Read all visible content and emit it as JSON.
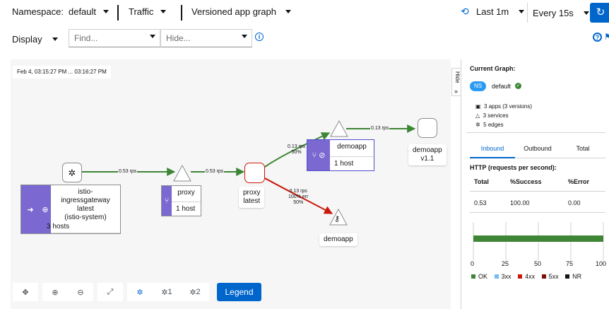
{
  "toolbar": {
    "namespace_label": "Namespace:",
    "namespace_value": "default",
    "traffic_label": "Traffic",
    "graph_type": "Versioned app graph",
    "duration": "Last 1m",
    "refresh_interval": "Every 15s"
  },
  "filters": {
    "display_label": "Display",
    "find_placeholder": "Find...",
    "hide_placeholder": "Hide..."
  },
  "graph": {
    "time_range": "Feb 4, 03:15:27 PM ... 03:16:27 PM",
    "hide_tab": "Hide",
    "edges": [
      {
        "label": "0.53 rps"
      },
      {
        "label": "0.53 rps"
      },
      {
        "label": "0.13 rps",
        "label2": "50%"
      },
      {
        "label": "0.13 rps"
      },
      {
        "label": "0.13 rps",
        "label2": "100% err",
        "label3": "50%"
      }
    ],
    "nodes": {
      "ingress": {
        "title_line1": "istio-ingressgateway",
        "title_line2": "latest",
        "title_line3": "(istio-system)",
        "hosts": "3 hosts"
      },
      "proxy_group": {
        "title": "proxy",
        "hosts": "1 host"
      },
      "proxy_latest": {
        "line1": "proxy",
        "line2": "latest"
      },
      "demoapp_group": {
        "title": "demoapp",
        "hosts": "1 host"
      },
      "demoapp_v11": {
        "line1": "demoapp",
        "line2": "v1.1"
      },
      "demoapp_ext": {
        "line1": "demoapp"
      }
    },
    "controls": {
      "layout1": "1",
      "layout2": "2",
      "legend": "Legend"
    }
  },
  "side": {
    "title": "Current Graph:",
    "ns_badge": "NS",
    "namespace": "default",
    "apps": "3 apps (3 versions)",
    "services": "3 services",
    "edges": "5 edges",
    "tabs": [
      "Inbound",
      "Outbound",
      "Total"
    ],
    "http_title": "HTTP (requests per second):",
    "table": {
      "headers": [
        "Total",
        "%Success",
        "%Error"
      ],
      "values": [
        "0.53",
        "100.00",
        "0.00"
      ]
    },
    "chart_ticks": [
      "0",
      "25",
      "50",
      "75",
      "100"
    ],
    "legend": [
      "OK",
      "3xx",
      "4xx",
      "5xx",
      "NR"
    ],
    "colors": {
      "ok": "#3e8635",
      "3xx": "#73bcf7",
      "4xx": "#c9190b",
      "5xx": "#7d1007",
      "nr": "#151515"
    }
  },
  "colors": {
    "accent": "#0066cc",
    "node_purple": "#7b68d0",
    "edge_ok": "#3e8635",
    "edge_err": "#c9190b"
  }
}
